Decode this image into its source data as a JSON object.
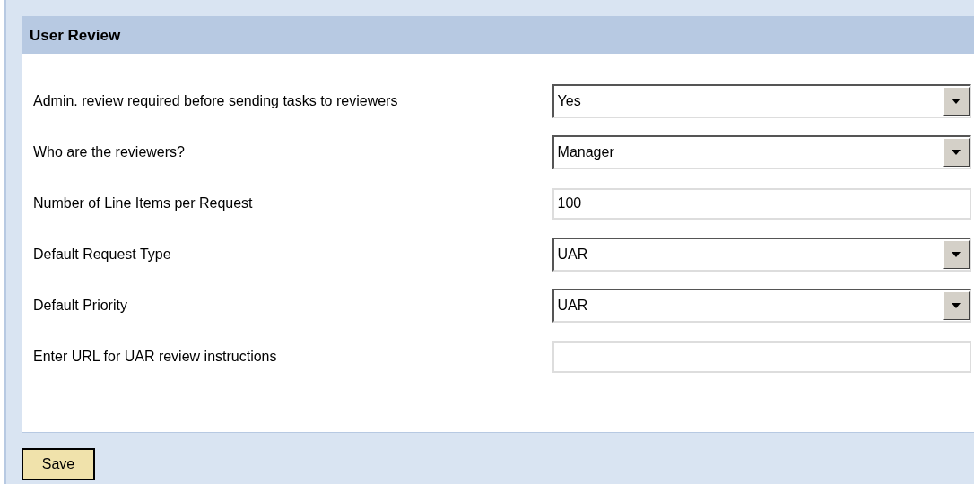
{
  "panel": {
    "title": "User Review"
  },
  "fields": [
    {
      "label": "Admin. review required before sending tasks to reviewers",
      "kind": "select",
      "value": "Yes"
    },
    {
      "label": "Who are the reviewers?",
      "kind": "select",
      "value": "Manager"
    },
    {
      "label": "Number of Line Items per Request",
      "kind": "text",
      "value": "100"
    },
    {
      "label": "Default Request Type",
      "kind": "select",
      "value": "UAR"
    },
    {
      "label": "Default Priority",
      "kind": "select",
      "value": "UAR"
    },
    {
      "label": "Enter URL for UAR review instructions",
      "kind": "text"
    }
  ],
  "buttons": [
    "Save"
  ]
}
